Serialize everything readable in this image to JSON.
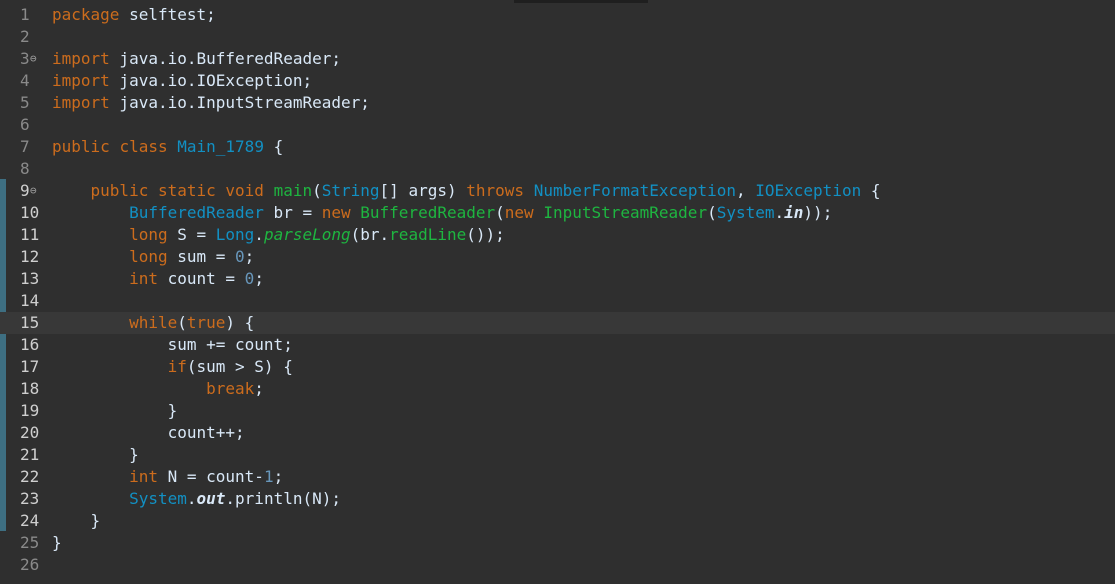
{
  "editor": {
    "lines": [
      {
        "n": "1",
        "tokens": [
          {
            "t": "package",
            "c": "kw"
          },
          {
            "t": " selftest;",
            "c": "pl"
          }
        ]
      },
      {
        "n": "2",
        "tokens": []
      },
      {
        "n": "3",
        "fold": "⊖",
        "tokens": [
          {
            "t": "import",
            "c": "kw"
          },
          {
            "t": " java.io.BufferedReader;",
            "c": "pl"
          }
        ]
      },
      {
        "n": "4",
        "tokens": [
          {
            "t": "import",
            "c": "kw"
          },
          {
            "t": " java.io.IOException;",
            "c": "pl"
          }
        ]
      },
      {
        "n": "5",
        "tokens": [
          {
            "t": "import",
            "c": "kw"
          },
          {
            "t": " java.io.InputStreamReader;",
            "c": "pl"
          }
        ]
      },
      {
        "n": "6",
        "tokens": []
      },
      {
        "n": "7",
        "tokens": [
          {
            "t": "public",
            "c": "kw"
          },
          {
            "t": " ",
            "c": "pl"
          },
          {
            "t": "class",
            "c": "kw"
          },
          {
            "t": " ",
            "c": "pl"
          },
          {
            "t": "Main_1789",
            "c": "ty"
          },
          {
            "t": " {",
            "c": "pl"
          }
        ]
      },
      {
        "n": "8",
        "tokens": []
      },
      {
        "n": "9",
        "fold": "⊖",
        "tokens": [
          {
            "t": "    ",
            "c": "pl"
          },
          {
            "t": "public",
            "c": "kw"
          },
          {
            "t": " ",
            "c": "pl"
          },
          {
            "t": "static",
            "c": "kw"
          },
          {
            "t": " ",
            "c": "pl"
          },
          {
            "t": "void",
            "c": "kw"
          },
          {
            "t": " ",
            "c": "pl"
          },
          {
            "t": "main",
            "c": "fn"
          },
          {
            "t": "(",
            "c": "pl"
          },
          {
            "t": "String",
            "c": "ty"
          },
          {
            "t": "[] ",
            "c": "pl"
          },
          {
            "t": "args",
            "c": "pl"
          },
          {
            "t": ") ",
            "c": "pl"
          },
          {
            "t": "throws",
            "c": "kw"
          },
          {
            "t": " ",
            "c": "pl"
          },
          {
            "t": "NumberFormatException",
            "c": "ty"
          },
          {
            "t": ", ",
            "c": "pl"
          },
          {
            "t": "IOException",
            "c": "ty"
          },
          {
            "t": " {",
            "c": "pl"
          }
        ]
      },
      {
        "n": "10",
        "tokens": [
          {
            "t": "        ",
            "c": "pl"
          },
          {
            "t": "BufferedReader",
            "c": "ty"
          },
          {
            "t": " br = ",
            "c": "pl"
          },
          {
            "t": "new",
            "c": "kw"
          },
          {
            "t": " ",
            "c": "pl"
          },
          {
            "t": "BufferedReader",
            "c": "fn"
          },
          {
            "t": "(",
            "c": "pl"
          },
          {
            "t": "new",
            "c": "kw"
          },
          {
            "t": " ",
            "c": "pl"
          },
          {
            "t": "InputStreamReader",
            "c": "fn"
          },
          {
            "t": "(",
            "c": "pl"
          },
          {
            "t": "System",
            "c": "ty"
          },
          {
            "t": ".",
            "c": "pl"
          },
          {
            "t": "in",
            "c": "it"
          },
          {
            "t": "));",
            "c": "pl"
          }
        ]
      },
      {
        "n": "11",
        "tokens": [
          {
            "t": "        ",
            "c": "pl"
          },
          {
            "t": "long",
            "c": "kw"
          },
          {
            "t": " S = ",
            "c": "pl"
          },
          {
            "t": "Long",
            "c": "ty"
          },
          {
            "t": ".",
            "c": "pl"
          },
          {
            "t": "parseLong",
            "c": "fn it2"
          },
          {
            "t": "(br.",
            "c": "pl"
          },
          {
            "t": "readLine",
            "c": "fn"
          },
          {
            "t": "());",
            "c": "pl"
          }
        ]
      },
      {
        "n": "12",
        "tokens": [
          {
            "t": "        ",
            "c": "pl"
          },
          {
            "t": "long",
            "c": "kw"
          },
          {
            "t": " sum = ",
            "c": "pl"
          },
          {
            "t": "0",
            "c": "nm"
          },
          {
            "t": ";",
            "c": "pl"
          }
        ]
      },
      {
        "n": "13",
        "tokens": [
          {
            "t": "        ",
            "c": "pl"
          },
          {
            "t": "int",
            "c": "kw"
          },
          {
            "t": " count = ",
            "c": "pl"
          },
          {
            "t": "0",
            "c": "nm"
          },
          {
            "t": ";",
            "c": "pl"
          }
        ]
      },
      {
        "n": "14",
        "tokens": []
      },
      {
        "n": "15",
        "current": true,
        "tokens": [
          {
            "t": "        ",
            "c": "pl"
          },
          {
            "t": "while",
            "c": "kw"
          },
          {
            "t": "(",
            "c": "pl"
          },
          {
            "t": "true",
            "c": "kw"
          },
          {
            "t": ") {",
            "c": "pl"
          }
        ]
      },
      {
        "n": "16",
        "tokens": [
          {
            "t": "            sum += count;",
            "c": "pl"
          }
        ]
      },
      {
        "n": "17",
        "tokens": [
          {
            "t": "            ",
            "c": "pl"
          },
          {
            "t": "if",
            "c": "kw"
          },
          {
            "t": "(sum > S) {",
            "c": "pl"
          }
        ]
      },
      {
        "n": "18",
        "tokens": [
          {
            "t": "                ",
            "c": "pl"
          },
          {
            "t": "break",
            "c": "kw"
          },
          {
            "t": ";",
            "c": "pl"
          }
        ]
      },
      {
        "n": "19",
        "tokens": [
          {
            "t": "            }",
            "c": "pl"
          }
        ]
      },
      {
        "n": "20",
        "tokens": [
          {
            "t": "            count++;",
            "c": "pl"
          }
        ]
      },
      {
        "n": "21",
        "tokens": [
          {
            "t": "        }",
            "c": "pl"
          }
        ]
      },
      {
        "n": "22",
        "tokens": [
          {
            "t": "        ",
            "c": "pl"
          },
          {
            "t": "int",
            "c": "kw"
          },
          {
            "t": " N = count-",
            "c": "pl"
          },
          {
            "t": "1",
            "c": "nm"
          },
          {
            "t": ";",
            "c": "pl"
          }
        ]
      },
      {
        "n": "23",
        "tokens": [
          {
            "t": "        ",
            "c": "pl"
          },
          {
            "t": "System",
            "c": "ty"
          },
          {
            "t": ".",
            "c": "pl"
          },
          {
            "t": "out",
            "c": "it"
          },
          {
            "t": ".println(N);",
            "c": "pl"
          }
        ]
      },
      {
        "n": "24",
        "tokens": [
          {
            "t": "    }",
            "c": "pl"
          }
        ]
      },
      {
        "n": "25",
        "tokens": [
          {
            "t": "}",
            "c": "pl"
          }
        ]
      },
      {
        "n": "26",
        "tokens": []
      }
    ]
  }
}
